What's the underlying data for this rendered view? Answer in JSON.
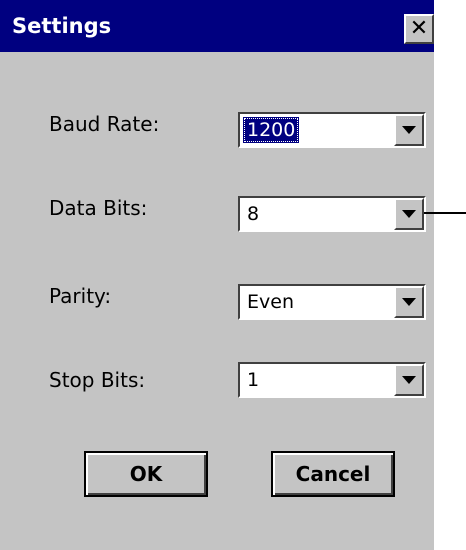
{
  "window": {
    "title": "Settings",
    "close_glyph": "✕",
    "colors": {
      "titlebar": "#000080",
      "face": "#c4c4c4",
      "selection": "#000080"
    }
  },
  "fields": [
    {
      "label": "Baud Rate:",
      "value": "1200",
      "focused": true
    },
    {
      "label": "Data Bits:",
      "value": "8",
      "focused": false
    },
    {
      "label": "Parity:",
      "value": "Even",
      "focused": false
    },
    {
      "label": "Stop Bits:",
      "value": "1",
      "focused": false
    }
  ],
  "buttons": {
    "ok": "OK",
    "cancel": "Cancel"
  }
}
